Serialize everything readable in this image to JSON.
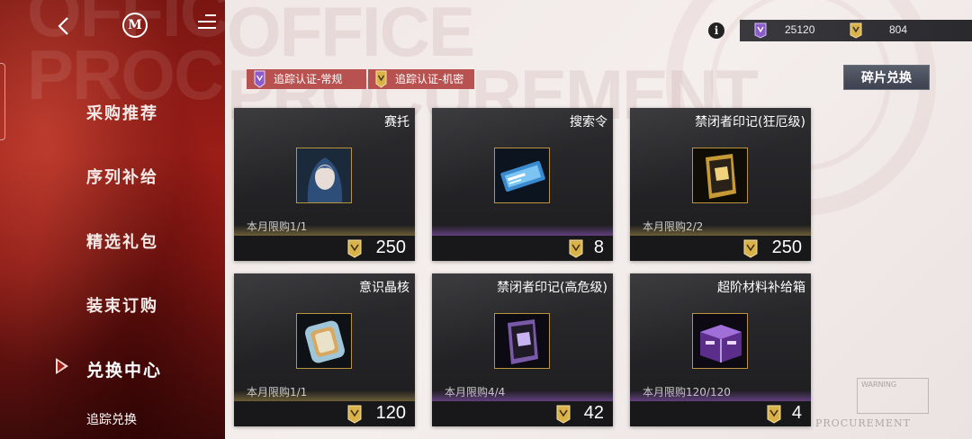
{
  "colors": {
    "accent_red": "#9b1d17",
    "card_bg": "#222225",
    "chip_red": "#b85250",
    "gold": "#d9b24a",
    "purple": "#8a5cc8"
  },
  "background_text": {
    "line1": "OFFICE",
    "line2": "PROCUREMENT"
  },
  "header": {
    "back_icon": "chevron-left-icon",
    "logo_letter": "M",
    "menu_icon": "menu-icon",
    "info_symbol": "i"
  },
  "currency": {
    "standard": "25120",
    "classified": "804"
  },
  "filters": [
    {
      "label": "追踪认证-常规",
      "icon": "standard-cert-icon"
    },
    {
      "label": "追踪认证-机密",
      "icon": "classified-cert-icon"
    }
  ],
  "fragment_button": "碎片兑换",
  "sidebar": {
    "items": [
      {
        "label": "采购推荐"
      },
      {
        "label": "序列补给"
      },
      {
        "label": "精选礼包"
      },
      {
        "label": "装束订购"
      },
      {
        "label": "兑换中心"
      }
    ],
    "sub_item": "追踪兑换"
  },
  "cards": [
    {
      "title": "赛托",
      "limit": "本月限购1/1",
      "price": "250",
      "glow": "gold"
    },
    {
      "title": "搜索令",
      "limit": "",
      "price": "8",
      "glow": "purple"
    },
    {
      "title": "禁闭者印记(狂厄级)",
      "limit": "本月限购2/2",
      "price": "250",
      "glow": "gold"
    },
    {
      "title": "意识晶核",
      "limit": "本月限购1/1",
      "price": "120",
      "glow": "gold"
    },
    {
      "title": "禁闭者印记(高危级)",
      "limit": "本月限购4/4",
      "price": "42",
      "glow": "purple"
    },
    {
      "title": "超阶材料补给箱",
      "limit": "本月限购120/120",
      "price": "4",
      "glow": "purple"
    }
  ],
  "footer": {
    "warning": "WARNING",
    "brand": "PROCUREMENT"
  }
}
